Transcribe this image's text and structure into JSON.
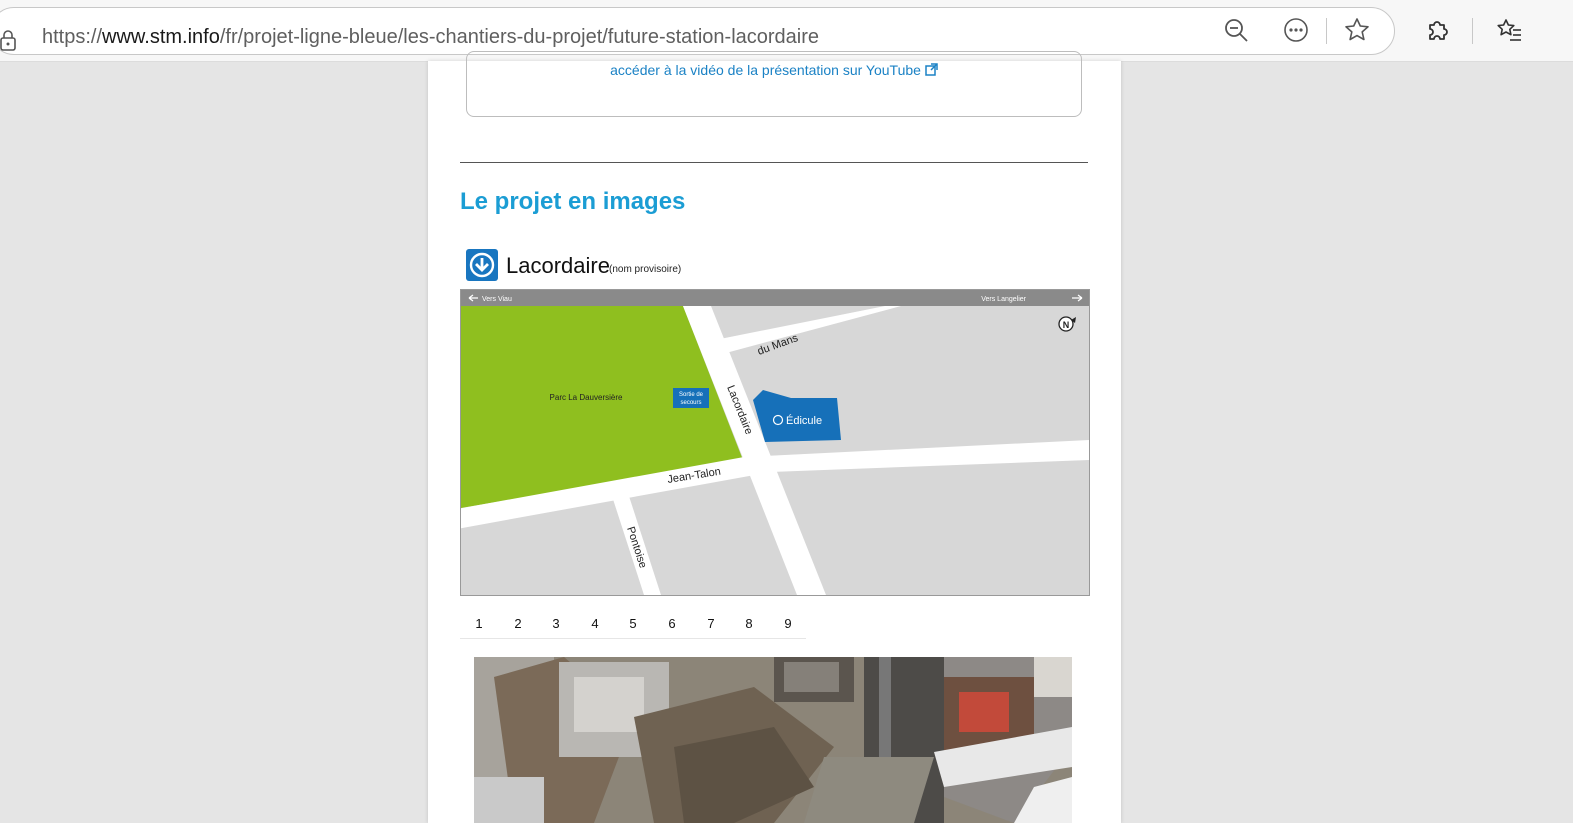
{
  "browser": {
    "url_prefix": "https://",
    "url_domain": "www.stm.info",
    "url_path": "/fr/projet-ligne-bleue/les-chantiers-du-projet/future-station-lacordaire",
    "icons": [
      "lock-icon",
      "zoom-out-icon",
      "more-icon",
      "favorite-star-icon",
      "extensions-icon",
      "favorites-list-icon"
    ]
  },
  "video": {
    "link_text": "accéder à la vidéo de la présentation sur YouTube"
  },
  "section": {
    "title": "Le projet en images"
  },
  "station": {
    "name": "Lacordaire",
    "note": "(nom provisoire)"
  },
  "map": {
    "top_left": "Vers Viau",
    "top_right": "Vers Langelier",
    "park": "Parc La Dauversière",
    "emergency_exit_line1": "Sortie de",
    "emergency_exit_line2": "secours",
    "edicule": "Édicule",
    "streets": {
      "du_mans": "du Mans",
      "lacordaire": "Lacordaire",
      "jean_talon": "Jean-Talon",
      "pontoise": "Pontoise"
    },
    "north": "N",
    "colors": {
      "park": "#8fbf1f",
      "block": "#d7d7d7",
      "road": "#ffffff",
      "brand": "#1670b9",
      "bar": "#8a8a8a"
    }
  },
  "pager": {
    "pages": [
      "1",
      "2",
      "3",
      "4",
      "5",
      "6",
      "7",
      "8",
      "9"
    ]
  }
}
